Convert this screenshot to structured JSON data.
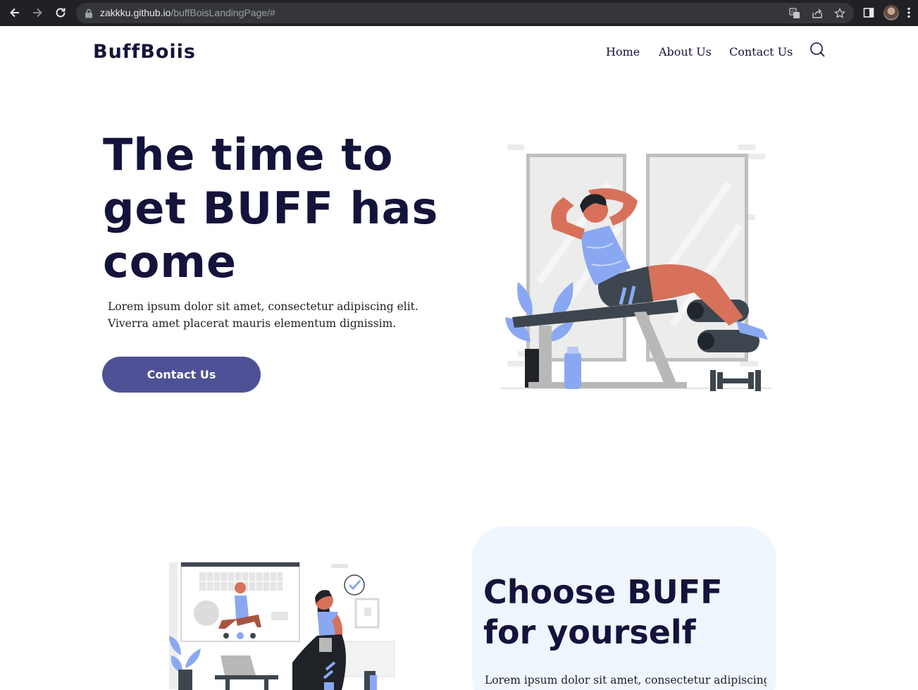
{
  "browser": {
    "url_host": "zakkku.github.io",
    "url_path": "/buffBoisLandingPage/#",
    "icons": [
      "back-icon",
      "forward-icon",
      "reload-icon",
      "lock-icon",
      "translate-icon",
      "share-icon",
      "star-icon",
      "side-panel-icon",
      "avatar",
      "menu-icon"
    ]
  },
  "header": {
    "logo": "BuffBoiis",
    "nav": [
      "Home",
      "About Us",
      "Contact Us"
    ],
    "search_icon": "search-icon"
  },
  "hero": {
    "title_lines": [
      "The time to",
      "get BUFF has",
      "come"
    ],
    "text": "Lorem ipsum dolor sit amet, consectetur adipiscing elit. Viverra amet placerat mauris elementum dignissim.",
    "cta_label": "Contact Us"
  },
  "section2": {
    "title_lines": [
      "Choose BUFF",
      "for yourself"
    ],
    "text": "Lorem ipsum dolor sit amet, consectetur adipiscing"
  },
  "colors": {
    "brand_dark": "#14133b",
    "cta": "#4f5196",
    "accent_blue": "#8aa8f2",
    "skin": "#d7715a",
    "card_bg": "#eff6fe"
  }
}
